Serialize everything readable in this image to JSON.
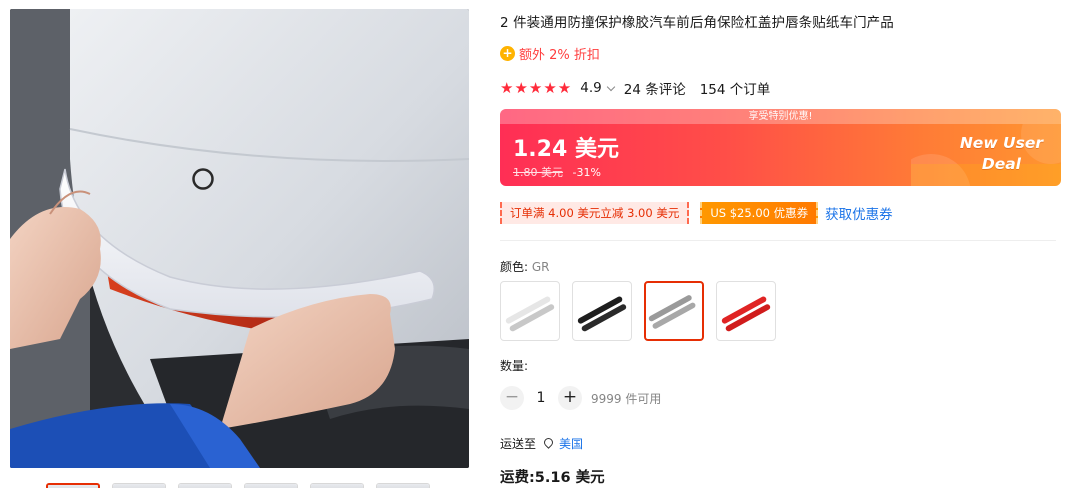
{
  "gallery": {
    "image_alt": "car bumper with white rubber protector strip",
    "thumb_count": 6,
    "active_thumb": 1
  },
  "product": {
    "title": "2 件装通用防撞保护橡胶汽车前后角保险杠盖护唇条贴纸车门产品",
    "extra_discount": "额外 2% 折扣",
    "extra_discount_icon": "coin-icon",
    "rating": {
      "stars": "★★★★★",
      "value": "4.9",
      "reviews": "24 条评论",
      "orders": "154 个订单"
    }
  },
  "price_banner": {
    "top_text": "享受特别优惠!",
    "price": "1.24 美元",
    "original_price": "1.80 美元",
    "discount": "-31%",
    "deal_line1": "New User",
    "deal_line2": "Deal",
    "gradient_start": "#ff2e55",
    "gradient_end": "#ff9630"
  },
  "coupons": {
    "store_coupon": "订单满 4.00 美元立减 3.00 美元",
    "platform_coupon": "US $25.00 优惠券",
    "get_coupons_link": "获取优惠券"
  },
  "color": {
    "label": "颜色:",
    "selected_value": "GR",
    "options": [
      {
        "name": "white",
        "stroke": "#e6e6e6",
        "shade": "#c8c8c8"
      },
      {
        "name": "black",
        "stroke": "#1e1e1e",
        "shade": "#555555"
      },
      {
        "name": "gray",
        "stroke": "#9a9a9a",
        "shade": "#c4c4c4"
      },
      {
        "name": "red",
        "stroke": "#e02424",
        "shade": "#ff6a6a"
      }
    ],
    "selected_index": 2
  },
  "quantity": {
    "label": "数量:",
    "minus": "−",
    "plus": "+",
    "value": "1",
    "stock": "9999 件可用"
  },
  "shipping": {
    "ship_to_label": "运送至",
    "country": "美国",
    "fee": "运费:5.16 美元"
  },
  "colors": {
    "accent_red": "#e62e04",
    "link_blue": "#1a73e8",
    "star_red": "#ff2b3b"
  }
}
